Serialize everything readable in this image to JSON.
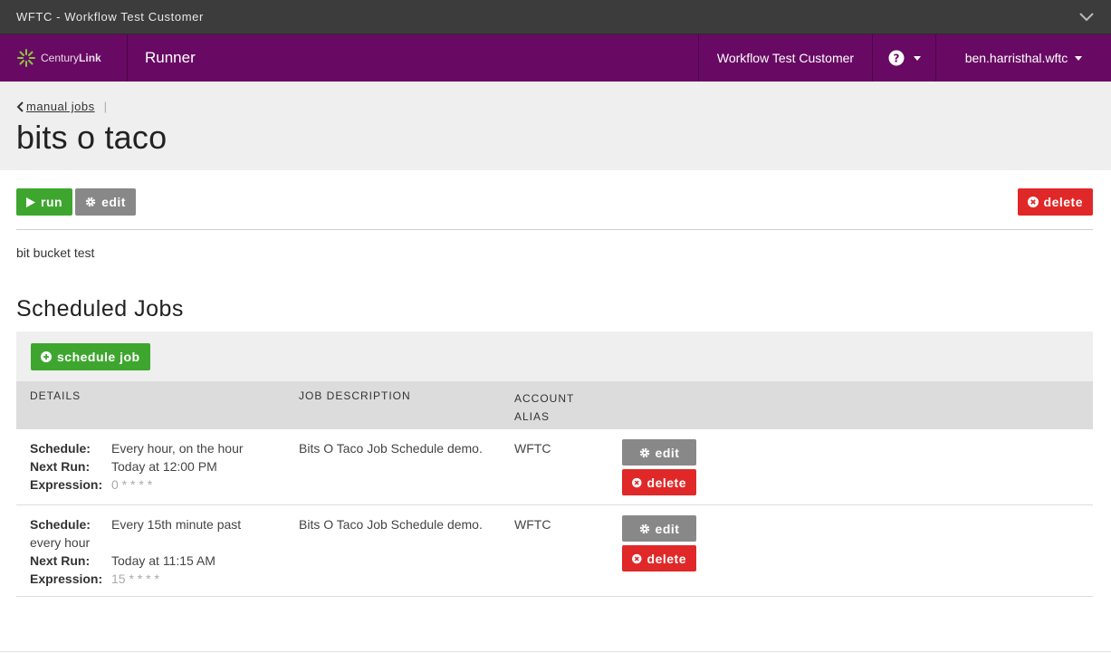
{
  "window": {
    "title": "WFTC - Workflow Test Customer"
  },
  "navbar": {
    "brand_text_light": "Century",
    "brand_text_bold": "Link",
    "app_name": "Runner",
    "customer": "Workflow Test Customer",
    "user": "ben.harristhal.wftc"
  },
  "header": {
    "breadcrumb": "manual jobs",
    "title": "bits o taco"
  },
  "toolbar": {
    "run_label": "run",
    "edit_label": "edit",
    "delete_label": "delete"
  },
  "description": "bit bucket test",
  "scheduled": {
    "title": "Scheduled Jobs",
    "add_label": "schedule job",
    "columns": [
      "DETAILS",
      "JOB DESCRIPTION",
      "ACCOUNT",
      "ALIAS"
    ],
    "labels": {
      "schedule": "Schedule:",
      "next_run": "Next Run:",
      "expression": "Expression:"
    },
    "rows": [
      {
        "schedule": "Every hour, on the hour",
        "next_run": "Today at 12:00 PM",
        "expression": "0 * * * *",
        "description": "Bits O Taco Job Schedule demo.",
        "alias": "WFTC",
        "edit": "edit",
        "delete": "delete"
      },
      {
        "schedule": "Every 15th minute past",
        "schedule_cont": "every hour",
        "next_run": "Today at 11:15 AM",
        "expression": "15 * * * *",
        "description": "Bits O Taco Job Schedule demo.",
        "alias": "WFTC",
        "edit": "edit",
        "delete": "delete"
      }
    ]
  },
  "colors": {
    "nav": "#680a63",
    "green": "#3ea62f",
    "red": "#e02828",
    "gray": "#888888"
  }
}
